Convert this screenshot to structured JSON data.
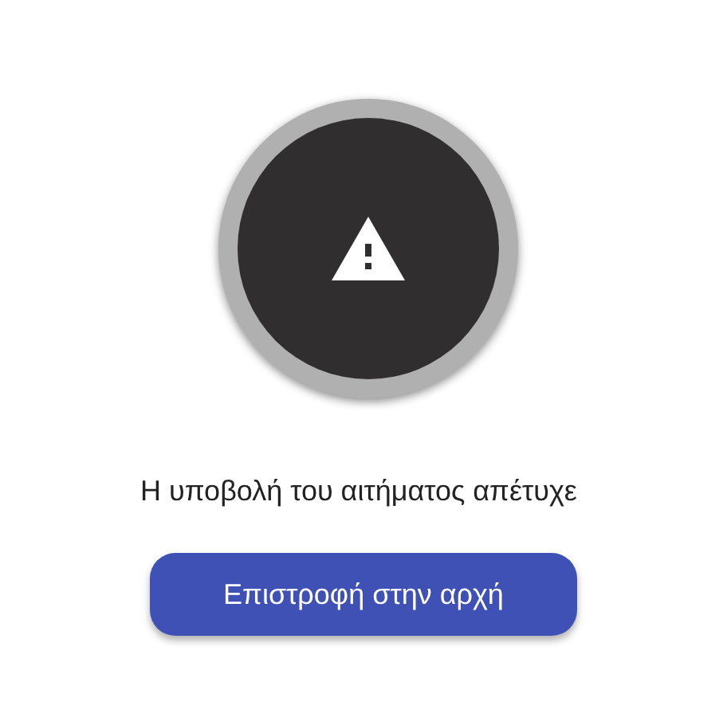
{
  "status": {
    "kind": "error"
  },
  "message": "Η υποβολή του αιτήματος απέτυχε",
  "button": {
    "label": "Επιστροφή στην αρχή"
  }
}
